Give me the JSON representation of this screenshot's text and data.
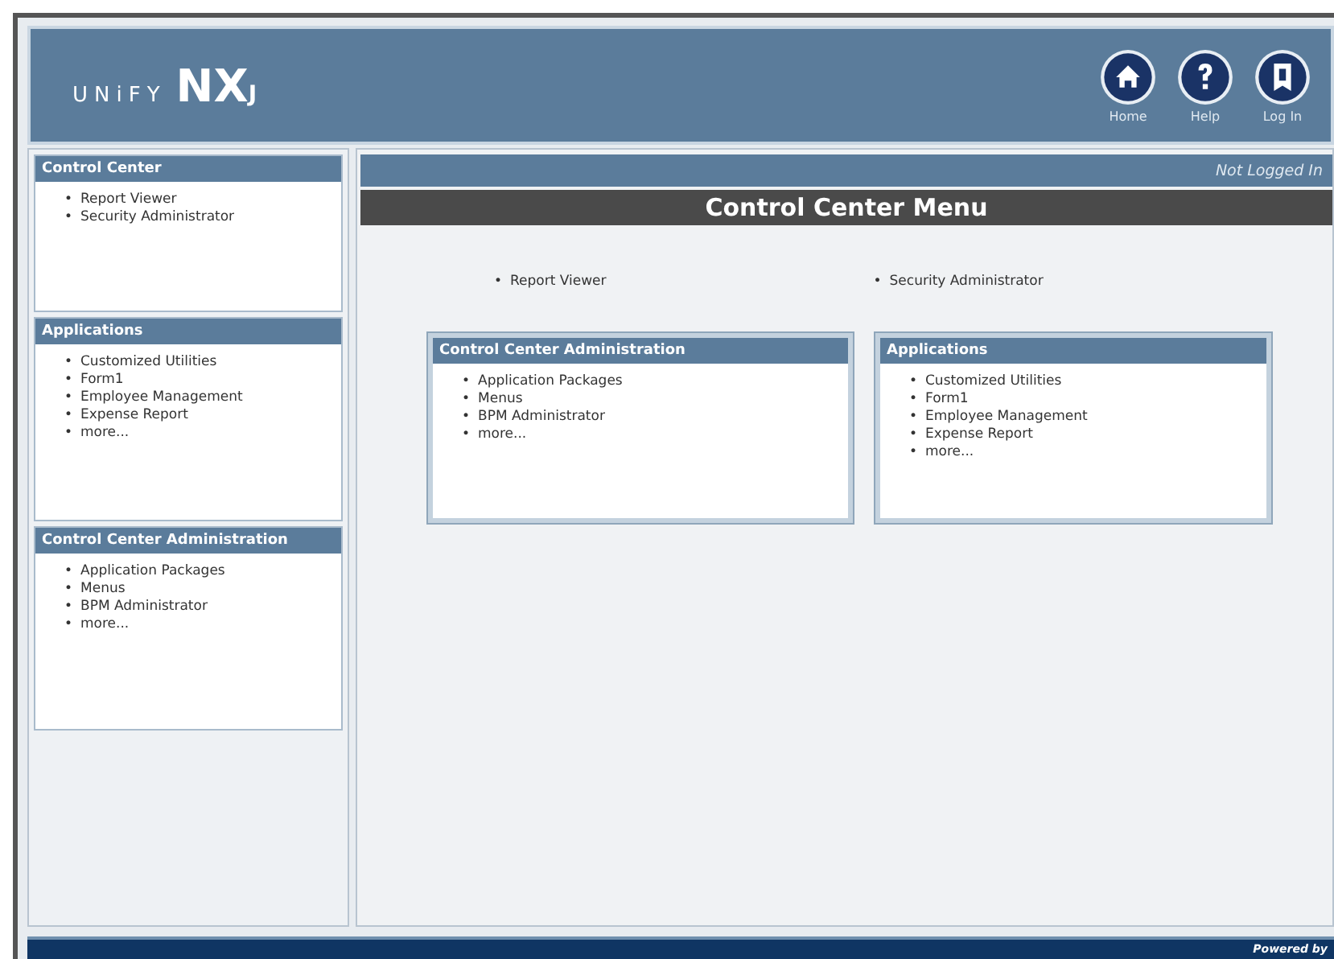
{
  "header": {
    "logo_left": "UNiFY",
    "logo_right": "NX",
    "logo_sup": "J",
    "nav": [
      {
        "kind": "home",
        "label": "Home"
      },
      {
        "kind": "help",
        "label": "Help"
      },
      {
        "kind": "login",
        "label": "Log In"
      }
    ]
  },
  "sidebar": [
    {
      "title": "Control Center",
      "items": [
        "Report Viewer",
        "Security Administrator"
      ]
    },
    {
      "title": "Applications",
      "items": [
        "Customized Utilities",
        "Form1",
        "Employee Management",
        "Expense Report",
        "more..."
      ]
    },
    {
      "title": "Control Center Administration",
      "items": [
        "Application Packages",
        "Menus",
        "BPM Administrator",
        "more..."
      ]
    }
  ],
  "status": "Not Logged In",
  "page_title": "Control Center Menu",
  "links": [
    "Report Viewer",
    "Security Administrator"
  ],
  "panels": [
    {
      "title": "Control Center Administration",
      "items": [
        "Application Packages",
        "Menus",
        "BPM Administrator",
        "more..."
      ]
    },
    {
      "title": "Applications",
      "items": [
        "Customized Utilities",
        "Form1",
        "Employee Management",
        "Expense Report",
        "more..."
      ]
    }
  ],
  "footer": "Powered by",
  "bullet": "•"
}
